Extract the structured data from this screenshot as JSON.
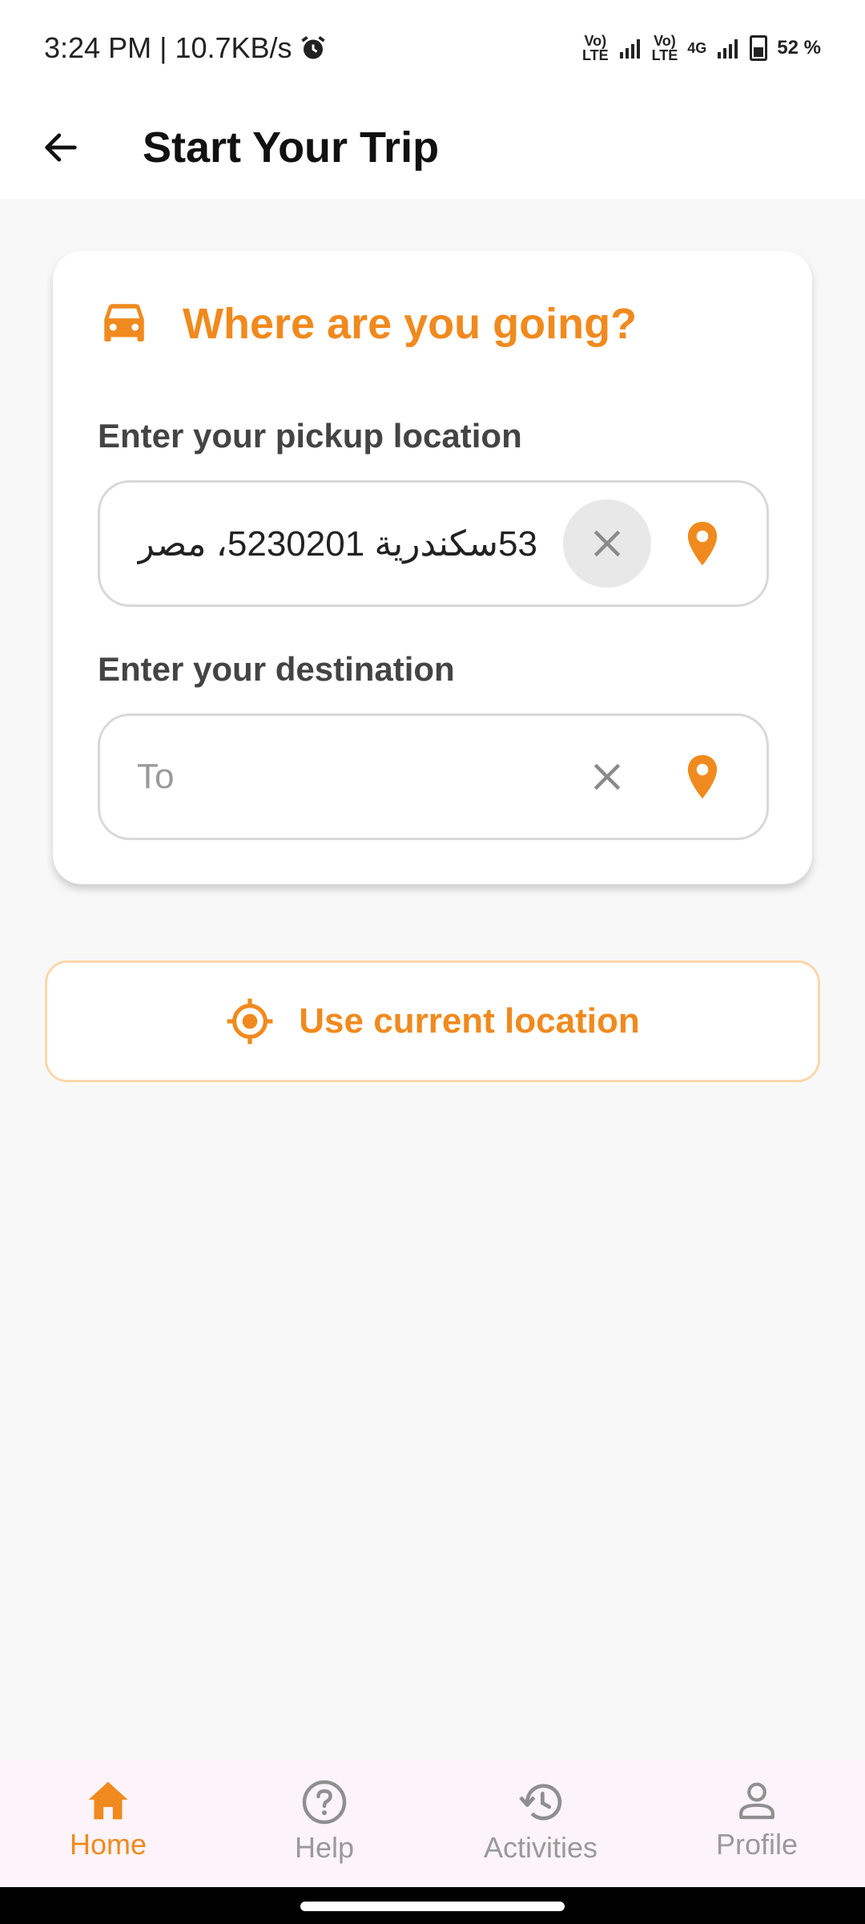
{
  "status_bar": {
    "time": "3:24 PM",
    "separator": " | ",
    "speed": "10.7KB/s",
    "sim1": "Vo)\nLTE",
    "sim2": "Vo)\nLTE",
    "network": "4G",
    "battery": "52 %"
  },
  "app_bar": {
    "title": "Start Your Trip"
  },
  "card": {
    "title": "Where are you going?",
    "pickup_label": "Enter your pickup location",
    "pickup_value": "53سكندرية 5230201، مصر",
    "destination_label": "Enter your destination",
    "destination_placeholder": "To"
  },
  "current_location": {
    "label": "Use current location"
  },
  "bottom_nav": {
    "items": [
      {
        "label": "Home",
        "icon": "home-icon",
        "active": true
      },
      {
        "label": "Help",
        "icon": "help-icon",
        "active": false
      },
      {
        "label": "Activities",
        "icon": "history-icon",
        "active": false
      },
      {
        "label": "Profile",
        "icon": "person-icon",
        "active": false
      }
    ]
  },
  "colors": {
    "accent": "#f08a1e",
    "accent_border": "#fbd7ac",
    "background": "#f8f8f8",
    "nav_background": "#fcf4fa"
  }
}
